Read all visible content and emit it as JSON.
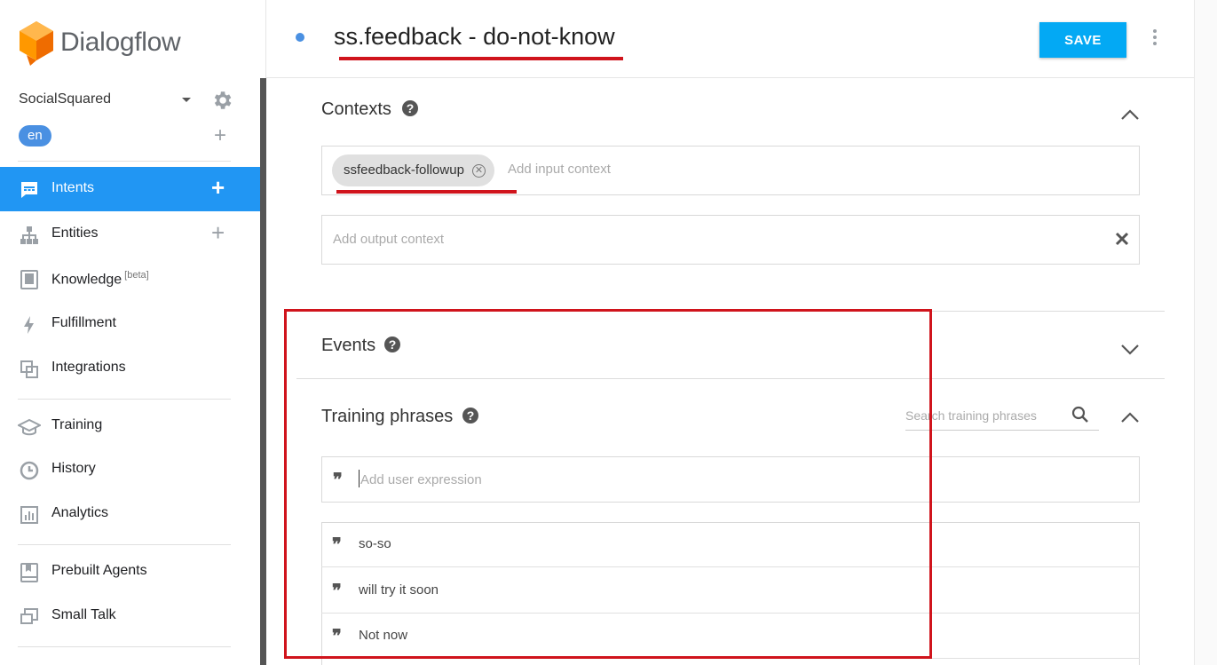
{
  "app": {
    "logo_text": "Dialogflow",
    "brand_color": "#ff9800"
  },
  "sidebar": {
    "agent_name": "SocialSquared",
    "language": "en",
    "items": [
      {
        "label": "Intents",
        "icon": "chat-icon",
        "active": true,
        "add": "+"
      },
      {
        "label": "Entities",
        "icon": "hierarchy-icon",
        "add": "+"
      },
      {
        "label": "Knowledge",
        "icon": "book-icon",
        "badge": "[beta]"
      },
      {
        "label": "Fulfillment",
        "icon": "bolt-icon"
      },
      {
        "label": "Integrations",
        "icon": "sync-icon"
      },
      {
        "label": "Training",
        "icon": "graduation-cap-icon"
      },
      {
        "label": "History",
        "icon": "clock-icon"
      },
      {
        "label": "Analytics",
        "icon": "bar-chart-icon"
      },
      {
        "label": "Prebuilt Agents",
        "icon": "bookmark-book-icon"
      },
      {
        "label": "Small Talk",
        "icon": "chat-squares-icon"
      }
    ]
  },
  "header": {
    "intent_name": "ss.feedback - do-not-know",
    "save_label": "SAVE",
    "accent_color": "#03a9f4"
  },
  "contexts": {
    "title": "Contexts",
    "input_chip": "ssfeedback-followup",
    "input_placeholder": "Add input context",
    "output_placeholder": "Add output context"
  },
  "events": {
    "title": "Events"
  },
  "training": {
    "title": "Training phrases",
    "search_placeholder": "Search training phrases",
    "add_placeholder": "Add user expression",
    "phrases": [
      "so-so",
      "will try it soon",
      "Not now"
    ]
  },
  "annotation_color": "#d0141c"
}
